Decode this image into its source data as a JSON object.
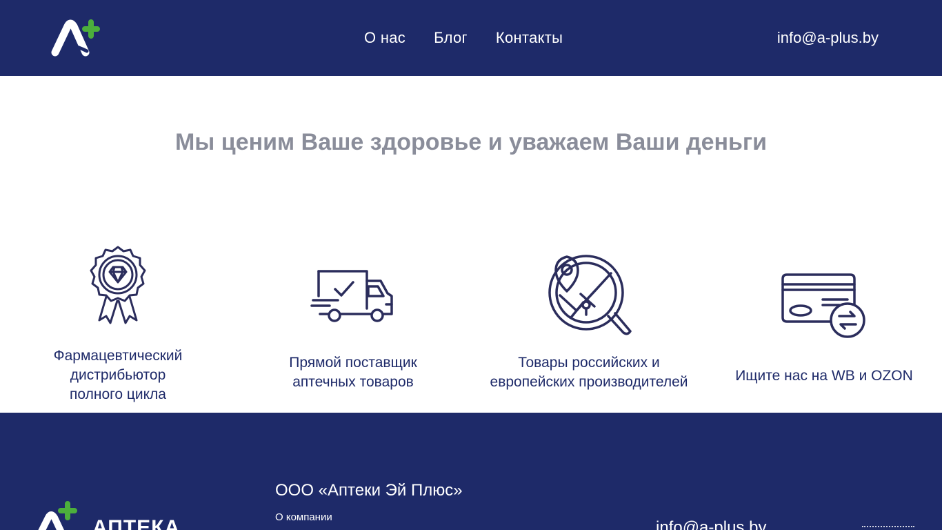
{
  "header": {
    "nav": [
      {
        "label": "О нас"
      },
      {
        "label": "Блог"
      },
      {
        "label": "Контакты"
      }
    ],
    "email": "info@a-plus.by"
  },
  "main": {
    "tagline": "Мы ценим Ваше здоровье и уважаем Ваши деньги",
    "features": [
      {
        "icon": "award-medal-icon",
        "label": "Фармацевтический\nдистрибьютор\nполного цикла"
      },
      {
        "icon": "delivery-truck-icon",
        "label": "Прямой поставщик\nаптечных товаров"
      },
      {
        "icon": "map-search-icon",
        "label": "Товары российских и\nевропейских производителей"
      },
      {
        "icon": "card-exchange-icon",
        "label": "Ищите нас на WB и OZON"
      }
    ]
  },
  "footer": {
    "brand": "АПТЕКА",
    "company": "ООО «Аптеки Эй Плюс»",
    "about": "О компании",
    "email": "info@a-plus.by"
  },
  "colors": {
    "navy": "#1e2a69",
    "green": "#4caf3c",
    "tagline_gray": "#8a8d9a",
    "icon_stroke": "#2b2d5c"
  }
}
